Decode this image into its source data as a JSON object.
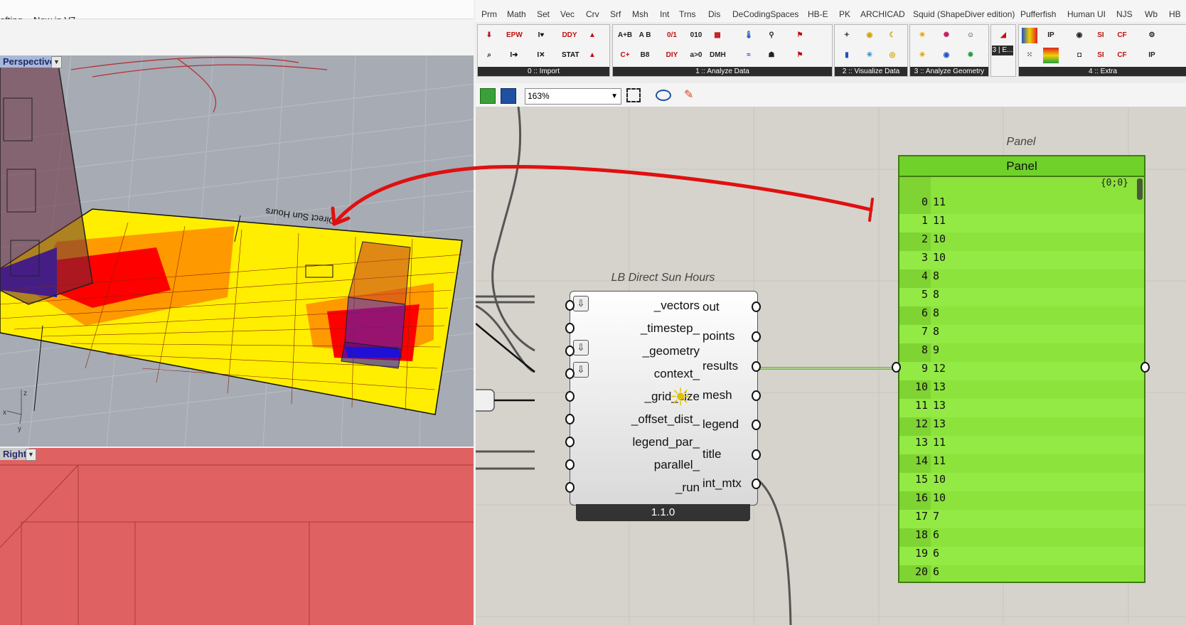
{
  "rhino": {
    "tabs": [
      "afting",
      "New in V7"
    ],
    "perspective_label": "Perspective",
    "right_label": "Right",
    "model_label": "Direct Sun Hours",
    "axis_labels": {
      "x": "x",
      "y": "y",
      "z": "z"
    }
  },
  "gh": {
    "menu": [
      "Prm",
      "Math",
      "Set",
      "Vec",
      "Crv",
      "Srf",
      "Msh",
      "Int",
      "Trns",
      "Dis",
      "DeCodingSpaces",
      "HB-E",
      "PK",
      "ARCHICAD",
      "Squid (ShapeDiver edition)",
      "Pufferfish",
      "Human UI",
      "NJS",
      "Wb",
      "HB"
    ],
    "ribbon_groups": [
      {
        "label": "0 :: Import"
      },
      {
        "label": "1 :: Analyze Data"
      },
      {
        "label": "2 :: Visualize Data"
      },
      {
        "label": "3 :: Analyze Geometry"
      },
      {
        "label": "3 | E..."
      },
      {
        "label": "4 :: Extra"
      }
    ],
    "zoom": "163%",
    "component": {
      "title": "LB Direct Sun Hours",
      "version": "1.1.0",
      "inputs": [
        "_vectors",
        "_timestep_",
        "_geometry",
        "context_",
        "_grid_size",
        "_offset_dist_",
        "legend_par_",
        "parallel_",
        "_run"
      ],
      "outputs": [
        "out",
        "points",
        "results",
        "mesh",
        "legend",
        "title",
        "int_mtx"
      ]
    },
    "panel": {
      "caption": "Panel",
      "title": "Panel",
      "path": "{0;0}",
      "rows": [
        {
          "i": "0",
          "v": "11"
        },
        {
          "i": "1",
          "v": "11"
        },
        {
          "i": "2",
          "v": "10"
        },
        {
          "i": "3",
          "v": "10"
        },
        {
          "i": "4",
          "v": "8"
        },
        {
          "i": "5",
          "v": "8"
        },
        {
          "i": "6",
          "v": "8"
        },
        {
          "i": "7",
          "v": "8"
        },
        {
          "i": "8",
          "v": "9"
        },
        {
          "i": "9",
          "v": "12"
        },
        {
          "i": "10",
          "v": "13"
        },
        {
          "i": "11",
          "v": "13"
        },
        {
          "i": "12",
          "v": "13"
        },
        {
          "i": "13",
          "v": "11"
        },
        {
          "i": "14",
          "v": "11"
        },
        {
          "i": "15",
          "v": "10"
        },
        {
          "i": "16",
          "v": "10"
        },
        {
          "i": "17",
          "v": "7"
        },
        {
          "i": "18",
          "v": "6"
        },
        {
          "i": "19",
          "v": "6"
        },
        {
          "i": "20",
          "v": "6"
        }
      ]
    }
  },
  "colors": {
    "panel": "#8be33c",
    "annotation": "#e01010",
    "heat_hot": "#ff0000",
    "heat_mid": "#ff9900",
    "heat_cool": "#ffee00",
    "shadow": "#1a10e0"
  }
}
